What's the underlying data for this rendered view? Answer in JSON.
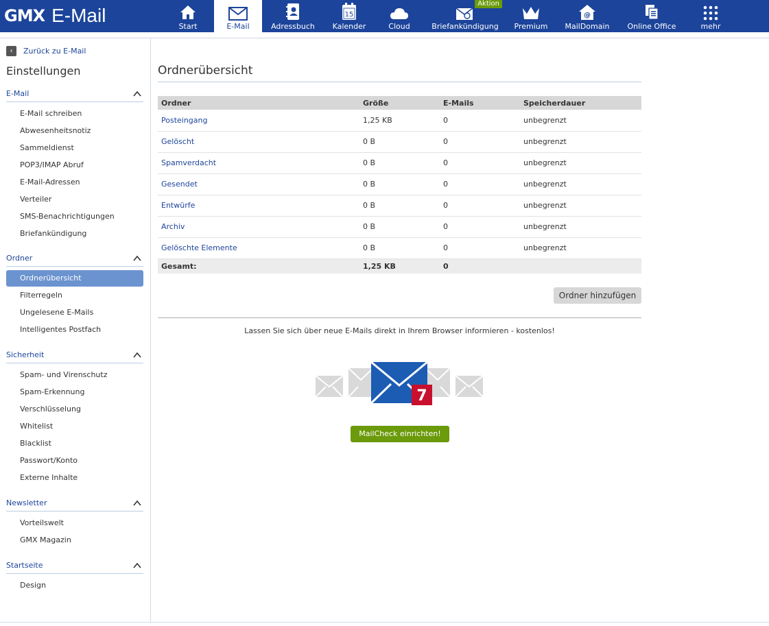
{
  "header": {
    "brand": "GMX",
    "product": "E-Mail",
    "nav": [
      {
        "label": "Start",
        "icon": "home-icon"
      },
      {
        "label": "E-Mail",
        "icon": "envelope-icon",
        "active": true
      },
      {
        "label": "Adressbuch",
        "icon": "addressbook-icon"
      },
      {
        "label": "Kalender",
        "icon": "calendar-icon",
        "icon_text": "15"
      },
      {
        "label": "Cloud",
        "icon": "cloud-icon"
      },
      {
        "label": "Briefankündigung",
        "icon": "letter-announce-icon",
        "badge": "Aktion"
      },
      {
        "label": "Premium",
        "icon": "crown-icon"
      },
      {
        "label": "MailDomain",
        "icon": "maildomain-icon"
      },
      {
        "label": "Online Office",
        "icon": "office-icon"
      },
      {
        "label": "mehr",
        "icon": "grid-icon"
      }
    ]
  },
  "sidebar": {
    "back_label": "Zurück zu E-Mail",
    "title": "Einstellungen",
    "sections": [
      {
        "title": "E-Mail",
        "items": [
          "E-Mail schreiben",
          "Abwesenheitsnotiz",
          "Sammeldienst",
          "POP3/IMAP Abruf",
          "E-Mail-Adressen",
          "Verteiler",
          "SMS-Benachrichtigungen",
          "Briefankündigung"
        ]
      },
      {
        "title": "Ordner",
        "items": [
          "Ordnerübersicht",
          "Filterregeln",
          "Ungelesene E-Mails",
          "Intelligentes Postfach"
        ],
        "active_item": "Ordnerübersicht"
      },
      {
        "title": "Sicherheit",
        "items": [
          "Spam- und Virenschutz",
          "Spam-Erkennung",
          "Verschlüsselung",
          "Whitelist",
          "Blacklist",
          "Passwort/Konto",
          "Externe Inhalte"
        ]
      },
      {
        "title": "Newsletter",
        "items": [
          "Vorteilswelt",
          "GMX Magazin"
        ]
      },
      {
        "title": "Startseite",
        "items": [
          "Design"
        ]
      }
    ]
  },
  "main": {
    "title": "Ordnerübersicht",
    "columns": [
      "Ordner",
      "Größe",
      "E-Mails",
      "Speicherdauer"
    ],
    "rows": [
      [
        "Posteingang",
        "1,25 KB",
        "0",
        "unbegrenzt"
      ],
      [
        "Gelöscht",
        "0 B",
        "0",
        "unbegrenzt"
      ],
      [
        "Spamverdacht",
        "0 B",
        "0",
        "unbegrenzt"
      ],
      [
        "Gesendet",
        "0 B",
        "0",
        "unbegrenzt"
      ],
      [
        "Entwürfe",
        "0 B",
        "0",
        "unbegrenzt"
      ],
      [
        "Archiv",
        "0 B",
        "0",
        "unbegrenzt"
      ],
      [
        "Gelöschte Elemente",
        "0 B",
        "0",
        "unbegrenzt"
      ]
    ],
    "total": [
      "Gesamt:",
      "1,25 KB",
      "0",
      ""
    ],
    "add_folder_label": "Ordner hinzufügen",
    "promo_text": "Lassen Sie sich über neue E-Mails direkt in Ihrem Browser informieren - kostenlos!",
    "promo_badge": "7",
    "mailcheck_label": "MailCheck einrichten!"
  },
  "colors": {
    "brand_blue": "#1c449b",
    "accent_green": "#6b9a0a",
    "active_item": "#6b93cf",
    "badge_red": "#c8102e"
  }
}
